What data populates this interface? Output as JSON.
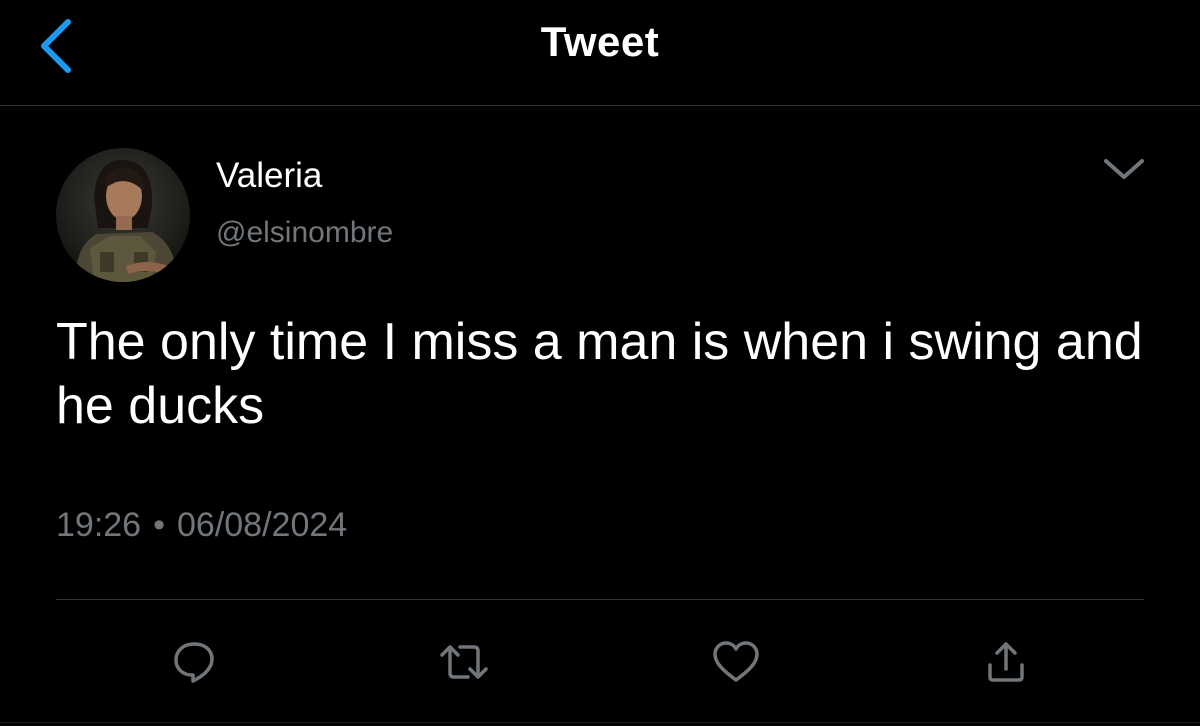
{
  "header": {
    "title": "Tweet",
    "back_icon": "chevron-left-icon",
    "accent_color": "#1d9bf0"
  },
  "author": {
    "display_name": "Valeria",
    "handle": "@elsinombre",
    "avatar": "avatar-photo"
  },
  "tweet": {
    "text": "The only time I miss a man is when i swing and he ducks",
    "time": "19:26",
    "separator": "•",
    "date": "06/08/2024"
  },
  "actions": [
    {
      "name": "reply",
      "icon": "reply-icon"
    },
    {
      "name": "retweet",
      "icon": "retweet-icon"
    },
    {
      "name": "like",
      "icon": "heart-icon"
    },
    {
      "name": "share",
      "icon": "share-icon"
    }
  ],
  "colors": {
    "background": "#000000",
    "primary_text": "#ffffff",
    "secondary_text": "#71767b",
    "divider": "#2f3336"
  }
}
